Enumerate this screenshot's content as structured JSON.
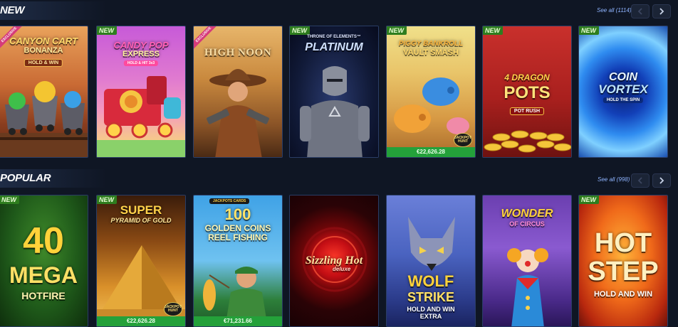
{
  "sections": {
    "new": {
      "title": "NEW",
      "see_all": "See all (1114)",
      "games": [
        {
          "name_line1": "CANYON CART",
          "name_line2": "BONANZA",
          "sub": "HOLD & WIN",
          "badge": "",
          "ribbon": "EXCLUSIVE"
        },
        {
          "name_line1": "CANDY POP",
          "name_line2": "EXPRESS",
          "sub": "HOLD & HIT 3x3",
          "badge": "NEW"
        },
        {
          "name_line1": "HIGH NOON",
          "name_line2": "",
          "sub": "",
          "badge": "",
          "ribbon": "EXCLUSIVE"
        },
        {
          "name_line0": "THRONE OF ELEMENTS™",
          "name_line1": "PLATINUM",
          "name_line2": "",
          "sub": "",
          "badge": "NEW"
        },
        {
          "name_line1": "PIGGY BANKROLL",
          "name_line2": "VAULT SMASH",
          "sub": "",
          "badge": "NEW",
          "jackpot": "€22,626.28",
          "jp_badge": "JACKPOT HUNT"
        },
        {
          "name_line1": "4 DRAGON",
          "name_line2": "POTS",
          "sub": "POT RUSH",
          "badge": "NEW"
        },
        {
          "name_line1": "COIN",
          "name_line2": "VORTEX",
          "sub": "HOLD THE SPIN",
          "badge": "NEW"
        }
      ]
    },
    "popular": {
      "title": "POPULAR",
      "see_all": "See all (998)",
      "games": [
        {
          "name_line1": "40",
          "name_line2": "MEGA",
          "sub": "HOTFIRE",
          "badge": "NEW"
        },
        {
          "name_line1": "SUPER",
          "name_line2": "PYRAMID OF GOLD",
          "sub": "",
          "badge": "NEW",
          "jackpot": "€22,626.28",
          "jp_badge": "JACKPOT HUNT"
        },
        {
          "name_line0": "JACKPOTS CARDS",
          "name_line1": "100",
          "name_line2": "GOLDEN COINS REEL FISHING",
          "sub": "",
          "badge": "",
          "jackpot": "€71,231.66"
        },
        {
          "name_line1": "Sizzling Hot",
          "name_line2": "deluxe",
          "sub": "",
          "badge": ""
        },
        {
          "name_line1": "WOLF",
          "name_line2": "STRIKE",
          "sub": "HOLD AND WIN EXTRA",
          "badge": ""
        },
        {
          "name_line1": "WONDER",
          "name_line2": "OF CIRCUS",
          "sub": "",
          "badge": ""
        },
        {
          "name_line1": "HOT",
          "name_line2": "STEP",
          "sub": "HOLD AND WIN",
          "badge": "NEW"
        }
      ]
    }
  },
  "icons": {
    "prev": "chevron-left-icon",
    "next": "chevron-right-icon"
  },
  "colors": {
    "background": "#0f1624",
    "new_badge": "#2e7d1e",
    "jackpot_bar": "#24a13a",
    "see_all_link": "#8fb4ff"
  }
}
